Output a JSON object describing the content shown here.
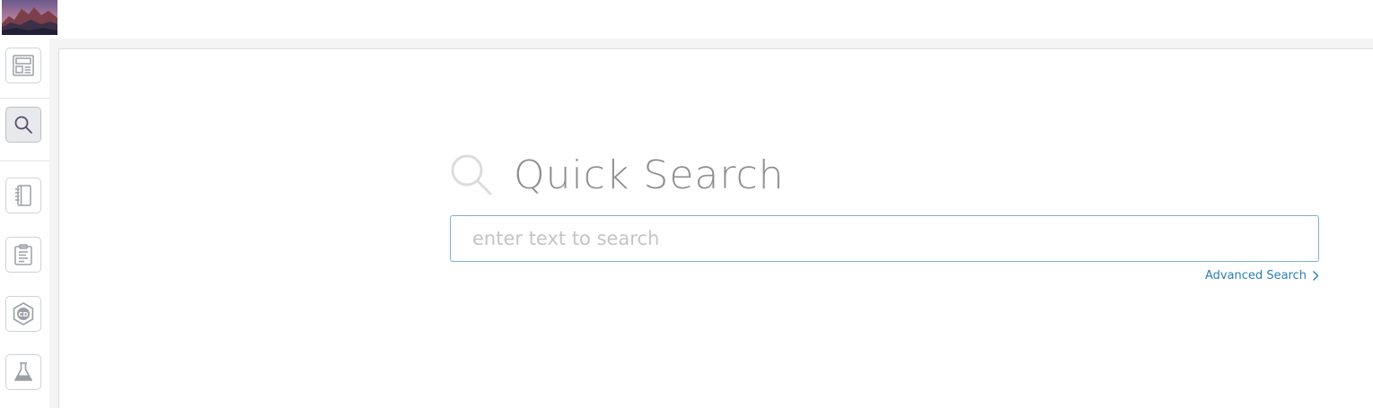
{
  "header": {
    "avatar_icon": "mountain-landscape-avatar"
  },
  "sidebar": {
    "items": [
      {
        "name": "dashboard",
        "icon": "layout-icon",
        "active": false
      },
      {
        "name": "quick-search",
        "icon": "search-icon",
        "active": true
      },
      {
        "name": "notebook",
        "icon": "notebook-icon",
        "active": false
      },
      {
        "name": "clipboard",
        "icon": "clipboard-icon",
        "active": false
      },
      {
        "name": "compound-discovery",
        "icon": "hexagon-cd-icon",
        "active": false
      },
      {
        "name": "lab",
        "icon": "flask-icon",
        "active": false
      }
    ]
  },
  "main": {
    "title": "Quick Search",
    "search": {
      "placeholder": "enter text to search",
      "value": ""
    },
    "advanced_search_label": "Advanced Search"
  },
  "colors": {
    "link": "#2b7fb3",
    "input_border": "#7fb0c9",
    "title": "#8e8e8e",
    "active_nav": "#e8e9ea"
  }
}
